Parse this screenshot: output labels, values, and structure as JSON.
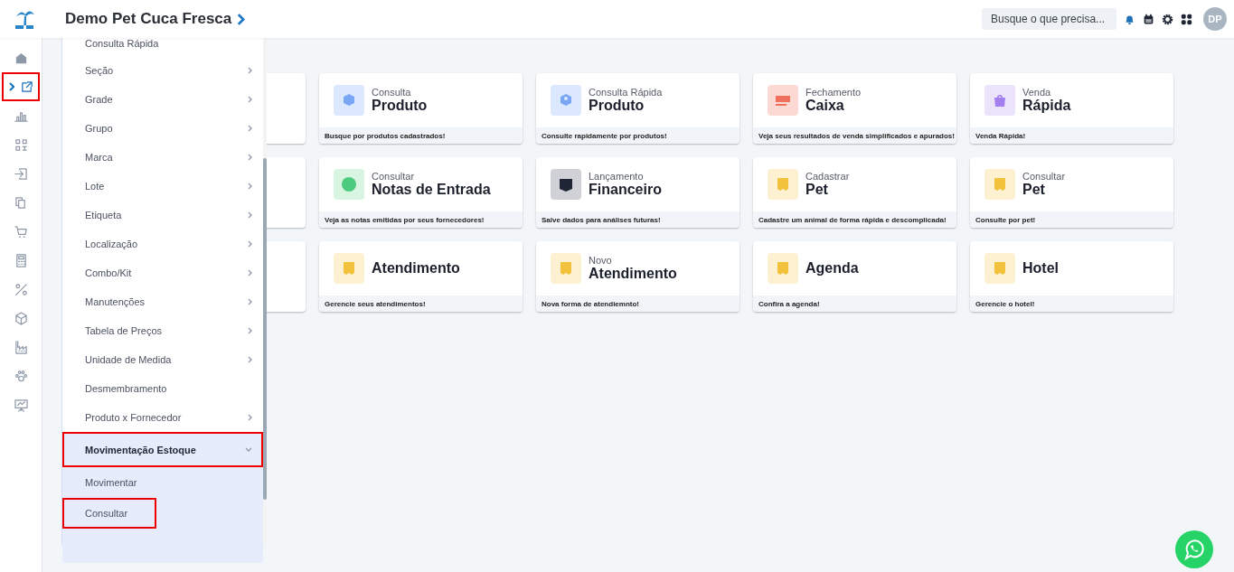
{
  "header": {
    "title": "Demo Pet Cuca Fresca",
    "search": {
      "placeholder": "Busque o que precisa..."
    },
    "avatar": "DP"
  },
  "rail": [
    {
      "kind": "home",
      "selected": false,
      "highlighted": false
    },
    {
      "kind": "external",
      "selected": true,
      "highlighted": true
    },
    {
      "kind": "chart",
      "selected": false,
      "highlighted": false
    },
    {
      "kind": "qr",
      "selected": false,
      "highlighted": false
    },
    {
      "kind": "login",
      "selected": false,
      "highlighted": false
    },
    {
      "kind": "copy",
      "selected": false,
      "highlighted": false
    },
    {
      "kind": "cart",
      "selected": false,
      "highlighted": false
    },
    {
      "kind": "calculator",
      "selected": false,
      "highlighted": false
    },
    {
      "kind": "percent",
      "selected": false,
      "highlighted": false
    },
    {
      "kind": "cube",
      "selected": false,
      "highlighted": false
    },
    {
      "kind": "factory",
      "selected": false,
      "highlighted": false
    },
    {
      "kind": "paw",
      "selected": false,
      "highlighted": false
    },
    {
      "kind": "presentation",
      "selected": false,
      "highlighted": false
    }
  ],
  "menu": [
    {
      "label": "Consulta Rápida",
      "submenu": false,
      "expanded": false,
      "highlighted": false
    },
    {
      "label": "Seção",
      "submenu": true,
      "expanded": false,
      "highlighted": false
    },
    {
      "label": "Grade",
      "submenu": true,
      "expanded": false,
      "highlighted": false
    },
    {
      "label": "Grupo",
      "submenu": true,
      "expanded": false,
      "highlighted": false
    },
    {
      "label": "Marca",
      "submenu": true,
      "expanded": false,
      "highlighted": false
    },
    {
      "label": "Lote",
      "submenu": true,
      "expanded": false,
      "highlighted": false
    },
    {
      "label": "Etiqueta",
      "submenu": true,
      "expanded": false,
      "highlighted": false
    },
    {
      "label": "Localização",
      "submenu": true,
      "expanded": false,
      "highlighted": false
    },
    {
      "label": "Combo/Kit",
      "submenu": true,
      "expanded": false,
      "highlighted": false
    },
    {
      "label": "Manutenções",
      "submenu": true,
      "expanded": false,
      "highlighted": false
    },
    {
      "label": "Tabela de Preços",
      "submenu": true,
      "expanded": false,
      "highlighted": false
    },
    {
      "label": "Unidade de Medida",
      "submenu": true,
      "expanded": false,
      "highlighted": false
    },
    {
      "label": "Desmembramento",
      "submenu": false,
      "expanded": false,
      "highlighted": false
    },
    {
      "label": "Produto x Fornecedor",
      "submenu": true,
      "expanded": false,
      "highlighted": false
    },
    {
      "label": "Movimentação Estoque",
      "submenu": true,
      "expanded": true,
      "highlighted": true,
      "children": [
        {
          "label": "Movimentar",
          "highlighted": false
        },
        {
          "label": "Consultar",
          "highlighted": true
        }
      ]
    }
  ],
  "cards": [
    {
      "kind": "box",
      "subtitle": "Consulta",
      "title": "Produto",
      "description": "Busque por produtos cadastrados!"
    },
    {
      "kind": "box-alt",
      "subtitle": "Consulta Rápida",
      "title": "Produto",
      "description": "Consulte rapidamente por produtos!"
    },
    {
      "kind": "register",
      "subtitle": "Fechamento",
      "title": "Caixa",
      "description": "Veja seus resultados de venda simplificados e apurados!"
    },
    {
      "kind": "bag",
      "subtitle": "Venda",
      "title": "Rápida",
      "description": "Venda Rápida!"
    },
    {
      "kind": "money",
      "subtitle": "Consultar",
      "title": "Notas de Entrada",
      "description": "Veja as notas emitidas por seus fornecedores!"
    },
    {
      "kind": "wallet",
      "subtitle": "Lançamento",
      "title": "Financeiro",
      "description": "Salve dados para análises futuras!"
    },
    {
      "kind": "note",
      "subtitle": "Cadastrar",
      "title": "Pet",
      "description": "Cadastre um animal de forma rápida e descomplicada!"
    },
    {
      "kind": "note",
      "subtitle": "Consultar",
      "title": "Pet",
      "description": "Consulte por pet!"
    },
    {
      "kind": "note",
      "title": "Atendimento",
      "description": "Gerencie seus atendimentos!"
    },
    {
      "kind": "note",
      "subtitle": "Novo",
      "title": "Atendimento",
      "description": "Nova forma de atendiemnto!"
    },
    {
      "kind": "note",
      "title": "Agenda",
      "description": "Confira a agenda!"
    },
    {
      "kind": "note",
      "title": "Hotel",
      "description": "Gerencie o hotel!"
    }
  ]
}
